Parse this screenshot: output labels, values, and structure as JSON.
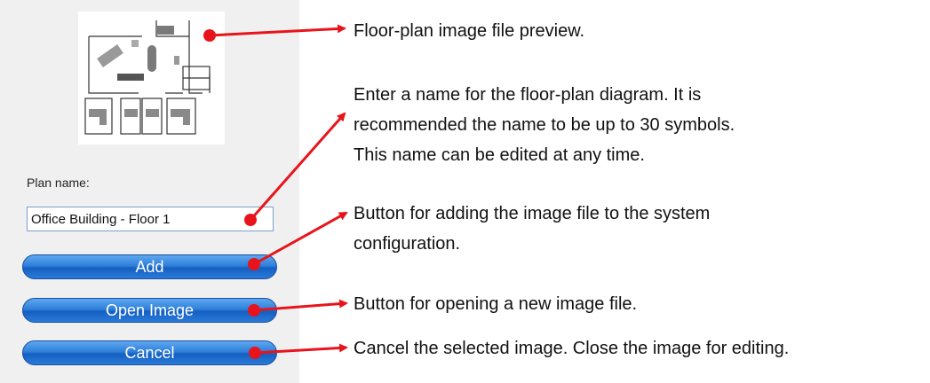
{
  "panel": {
    "plan_name_label": "Plan name:",
    "plan_name_value": "Office Building - Floor 1",
    "add_label": "Add",
    "open_image_label": "Open Image",
    "cancel_label": "Cancel"
  },
  "annotations": {
    "preview": "Floor-plan image file preview.",
    "name_line1": "Enter a name for the floor-plan diagram. It is",
    "name_line2": "recommended the name to be up to 30 symbols.",
    "name_line3": "This name can be edited at any time.",
    "add_line1": "Button for adding the image file to the system",
    "add_line2": "configuration.",
    "open": "Button for opening a new image file.",
    "cancel": "Cancel the selected image. Close the image for editing."
  },
  "colors": {
    "arrow": "#e8141b",
    "button": "#2f7fd9",
    "panel_background": "#f0f0f0"
  }
}
